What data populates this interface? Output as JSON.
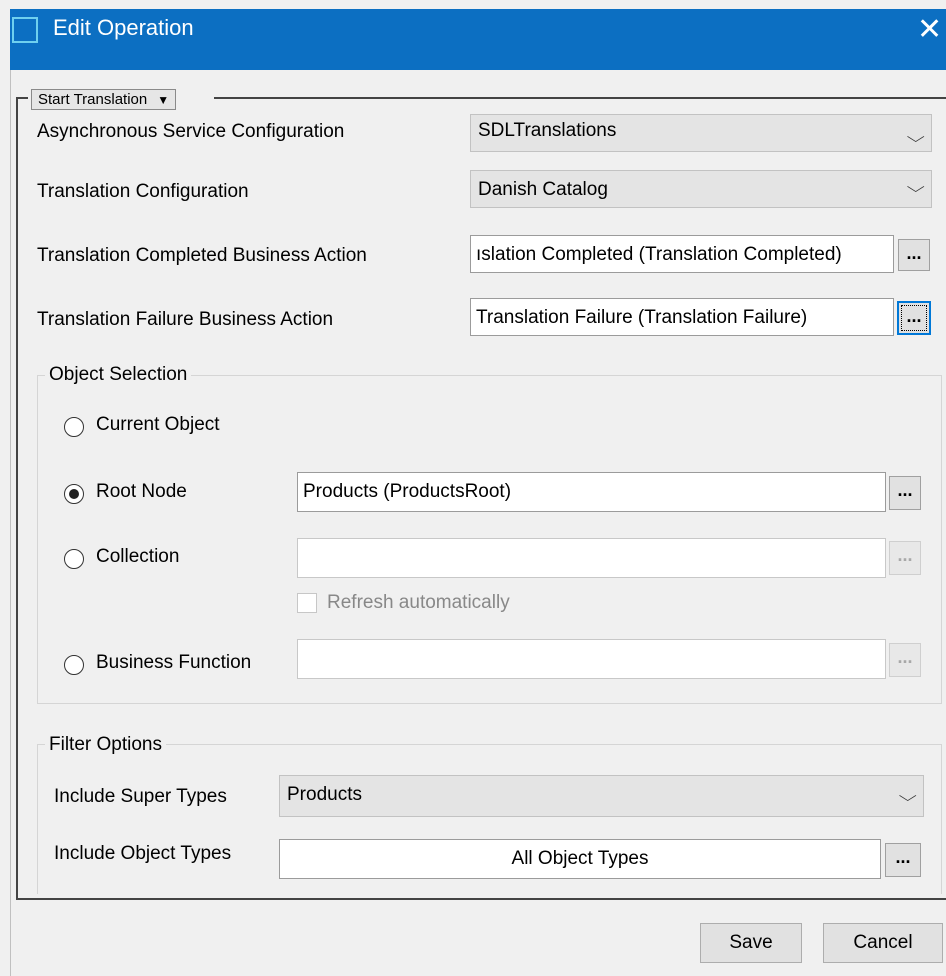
{
  "window": {
    "title": "Edit Operation",
    "close_glyph": "✕"
  },
  "operation_select": {
    "value": "Start Translation",
    "caret": "▼"
  },
  "fields": {
    "async_config": {
      "label": "Asynchronous Service Configuration",
      "value": "SDLTranslations"
    },
    "translation_config": {
      "label": "Translation Configuration",
      "value": "Danish Catalog"
    },
    "completed_action": {
      "label": "Translation Completed Business Action",
      "value": "ıslation Completed (Translation Completed)"
    },
    "failure_action": {
      "label": "Translation Failure Business Action",
      "value": "Translation Failure (Translation Failure)"
    }
  },
  "object_selection": {
    "title": "Object Selection",
    "current_object": {
      "label": "Current Object"
    },
    "root_node": {
      "label": "Root Node",
      "value": "Products (ProductsRoot)"
    },
    "collection": {
      "label": "Collection",
      "value": ""
    },
    "refresh": {
      "label": "Refresh automatically"
    },
    "business_function": {
      "label": "Business Function",
      "value": ""
    }
  },
  "filter_options": {
    "title": "Filter Options",
    "super_types": {
      "label": "Include Super Types",
      "value": "Products"
    },
    "object_types": {
      "label": "Include Object Types",
      "value": "All Object Types"
    }
  },
  "browse_label": "...",
  "chevron": "⌵",
  "buttons": {
    "save": "Save",
    "cancel": "Cancel"
  },
  "colors": {
    "title_bar": "#0c6fc2",
    "focus": "#0078d7"
  }
}
